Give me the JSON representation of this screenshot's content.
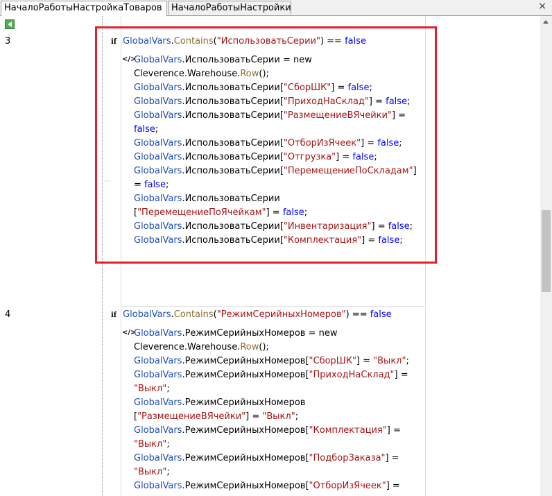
{
  "tabs": [
    {
      "label": "НачалоРаботыНастройкаТоваров"
    },
    {
      "label": "НачалоРаботыНастройки"
    }
  ],
  "close_label": "×",
  "icons": {
    "back": "back-arrow-icon",
    "if": "if-keyword-icon",
    "code": "code-block-icon"
  },
  "colors": {
    "highlight": "#e0202a",
    "identifier": "#1f4eb4",
    "method": "#8b6d2f",
    "string": "#a31515",
    "keyword": "#0000ff"
  },
  "blocks": [
    {
      "row": "3",
      "if_kw": "if",
      "condition": {
        "obj": "GlobalVars",
        "dot": ".",
        "method": "Contains",
        "open": "(",
        "arg": "\"ИспользоватьСерии\"",
        "close": ") == ",
        "kw": "false"
      },
      "code_icon": "</>",
      "lines": [
        "GlobalVars.ИспользоватьСерии = new",
        "Cleverence.Warehouse.Row();",
        "GlobalVars.ИспользоватьСерии[\"СборШК\"] = false;",
        "GlobalVars.ИспользоватьСерии[\"ПриходНаСклад\"] = false;",
        "GlobalVars.ИспользоватьСерии[\"РазмещениеВЯчейки\"] =",
        "false;",
        "GlobalVars.ИспользоватьСерии[\"ОтборИзЯчеек\"] = false;",
        "GlobalVars.ИспользоватьСерии[\"Отгрузка\"] = false;",
        "GlobalVars.ИспользоватьСерии[\"ПеремещениеПоСкладам\"]",
        "= false;",
        "GlobalVars.ИспользоватьСерии",
        "[\"ПеремещениеПоЯчейкам\"] = false;",
        "GlobalVars.ИспользоватьСерии[\"Инвентаризация\"] = false;",
        "GlobalVars.ИспользоватьСерии[\"Комплектация\"] = false;"
      ]
    },
    {
      "row": "4",
      "if_kw": "if",
      "condition": {
        "obj": "GlobalVars",
        "dot": ".",
        "method": "Contains",
        "open": "(",
        "arg": "\"РежимСерийныхНомеров\"",
        "close": ") == ",
        "kw": "false"
      },
      "code_icon": "</>",
      "lines": [
        "GlobalVars.РежимСерийныхНомеров = new",
        "Cleverence.Warehouse.Row();",
        "GlobalVars.РежимСерийныхНомеров[\"СборШК\"] = \"Выкл\";",
        "GlobalVars.РежимСерийныхНомеров[\"ПриходНаСклад\"] =",
        "\"Выкл\";",
        "GlobalVars.РежимСерийныхНомеров",
        "[\"РазмещениеВЯчейки\"] = \"Выкл\";",
        "GlobalVars.РежимСерийныхНомеров[\"Комплектация\"] =",
        "\"Выкл\";",
        "GlobalVars.РежимСерийныхНомеров[\"ПодборЗаказа\"] =",
        "\"Выкл\";",
        "GlobalVars.РежимСерийныхНомеров[\"ОтборИзЯчеек\"] ="
      ]
    }
  ]
}
